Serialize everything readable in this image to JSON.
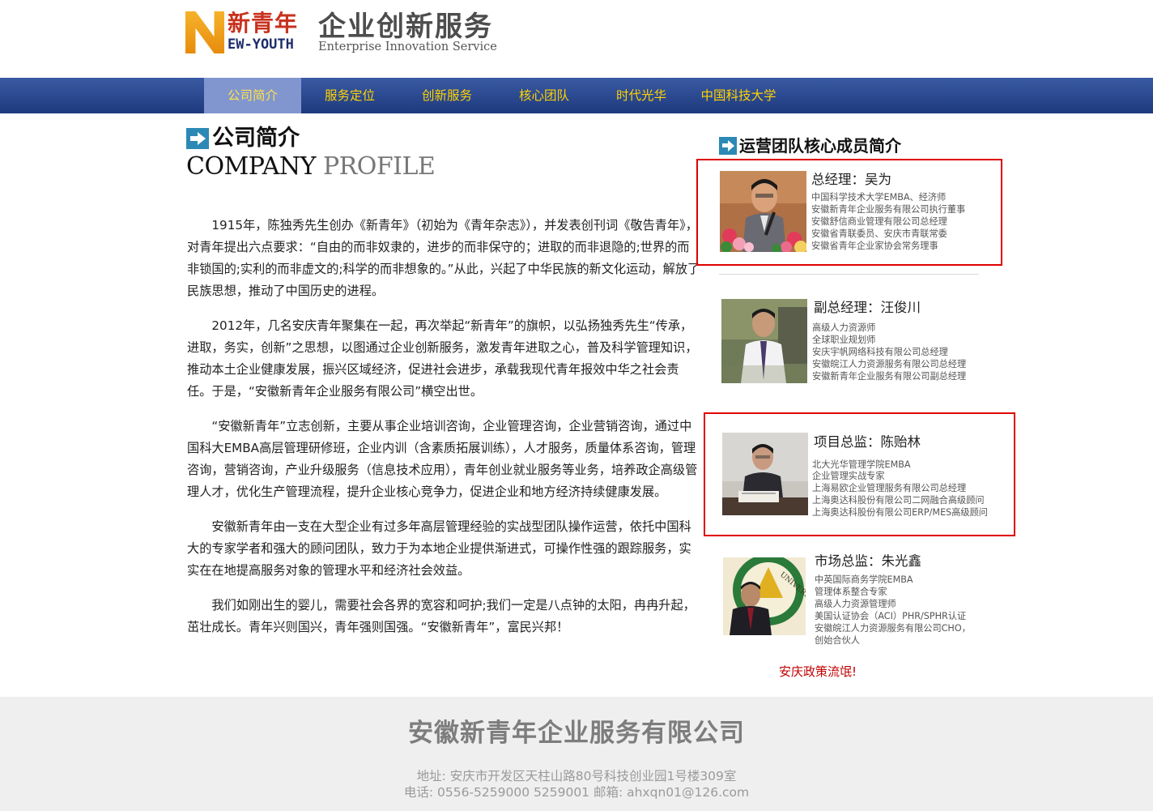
{
  "header": {
    "logo_cn": "新青年",
    "logo_en": "EW-YOUTH",
    "brand_cn": "企业创新服务",
    "brand_en": "Enterprise Innovation Service"
  },
  "nav": {
    "items": [
      {
        "label": "公司简介",
        "active": true
      },
      {
        "label": "服务定位"
      },
      {
        "label": "创新服务"
      },
      {
        "label": "核心团队"
      },
      {
        "label": "时代光华"
      },
      {
        "label": "中国科技大学"
      }
    ]
  },
  "profile": {
    "title_cn": "公司简介",
    "title_en_1": "COMPANY",
    "title_en_2": "PROFILE",
    "paragraphs": [
      "1915年，陈独秀先生创办《新青年》（初始为《青年杂志》），并发表创刊词《敬告青年》，对青年提出六点要求：“自由的而非奴隶的，进步的而非保守的；进取的而非退隐的;世界的而非锁国的;实利的而非虚文的;科学的而非想象的。”从此，兴起了中华民族的新文化运动，解放了民族思想，推动了中国历史的进程。",
      "2012年，几名安庆青年聚集在一起，再次举起“新青年”的旗帜，以弘扬独秀先生“传承，进取，务实，创新”之思想，以图通过企业创新服务，激发青年进取之心，普及科学管理知识，推动本土企业健康发展，振兴区域经济，促进社会进步，承载我现代青年报效中华之社会责任。于是，“安徽新青年企业服务有限公司”横空出世。",
      "“安徽新青年”立志创新，主要从事企业培训咨询，企业管理咨询，企业营销咨询，通过中国科大EMBA高层管理研修班，企业内训（含素质拓展训练），人才服务，质量体系咨询，管理咨询，营销咨询，产业升级服务（信息技术应用），青年创业就业服务等业务，培养政企高级管理人才，优化生产管理流程，提升企业核心竞争力，促进企业和地方经济持续健康发展。",
      "安徽新青年由一支在大型企业有过多年高层管理经验的实战型团队操作运营，依托中国科大的专家学者和强大的顾问团队，致力于为本地企业提供渐进式，可操作性强的跟踪服务，实实在在地提高服务对象的管理水平和经济社会效益。",
      "我们如刚出生的婴儿，需要社会各界的宽容和呵护;我们一定是八点钟的太阳，冉冉升起，茁壮成长。青年兴则国兴，青年强则国强。“安徽新青年”，富民兴邦！"
    ]
  },
  "team": {
    "title": "运营团队核心成员简介",
    "members": [
      {
        "name": "总经理：吴为",
        "desc": [
          "中国科学技术大学EMBA、经济师",
          "安徽新青年企业服务有限公司执行董事",
          "安徽舒信商业管理有限公司总经理",
          "安徽省青联委员、安庆市青联常委",
          "安徽省青年企业家协会常务理事"
        ]
      },
      {
        "name": "副总经理：汪俊川",
        "desc": [
          "高级人力资源师",
          "全球职业规划师",
          "安庆宇帆网络科技有限公司总经理",
          "安徽皖江人力资源服务有限公司总经理",
          "安徽新青年企业服务有限公司副总经理"
        ]
      },
      {
        "name": "项目总监：陈贻林",
        "desc": [
          "北大光华管理学院EMBA",
          "企业管理实战专家",
          "上海易欧企业管理服务有限公司总经理",
          "上海奥达科股份有限公司二网融合高级顾问",
          "上海奥达科股份有限公司ERP/MES高级顾问"
        ]
      },
      {
        "name": "市场总监：朱光鑫",
        "desc": [
          "中英国际商务学院EMBA",
          "管理体系整合专家",
          "高级人力资源管理师",
          "美国认证协会（ACI）PHR/SPHR认证",
          "安徽皖江人力资源服务有限公司CHO，",
          "创始合伙人"
        ],
        "photo_text": "UNIVERSITY"
      }
    ],
    "policy_link": "安庆政策流氓!"
  },
  "footer": {
    "company": "安徽新青年企业服务有限公司",
    "address": "地址: 安庆市开发区天柱山路80号科技创业园1号楼309室",
    "contact": "电话: 0556-5259000 5259001 邮箱: ahxqn01@126.com"
  },
  "colors": {
    "nav_bg": "#2a4890",
    "nav_active": "#8196cf",
    "nav_text": "#ffd300",
    "highlight_box": "#e00000",
    "footer_bg": "#efefef"
  }
}
